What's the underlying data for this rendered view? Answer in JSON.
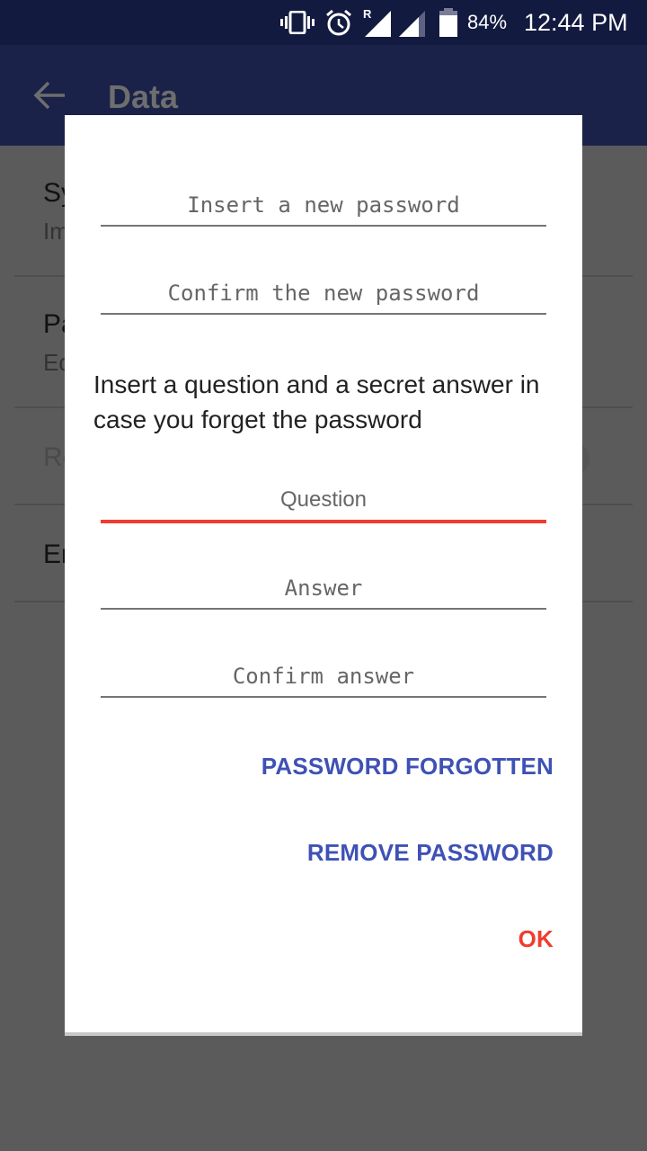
{
  "status_bar": {
    "icons": [
      "vibrate-icon",
      "alarm-icon",
      "signal-roaming-icon",
      "signal-icon",
      "battery-icon"
    ],
    "roaming_label": "R",
    "battery_percent": "84%",
    "time": "12:44 PM"
  },
  "app_bar": {
    "back_icon": "arrow-back-icon",
    "title": "Data"
  },
  "background_list": {
    "items": [
      {
        "title": "Sy",
        "subtitle": "Im"
      },
      {
        "title": "Pa",
        "subtitle": "Ed"
      },
      {
        "title": "Re",
        "subtitle": ""
      },
      {
        "title": "En",
        "subtitle": ""
      }
    ]
  },
  "dialog": {
    "new_password_placeholder": "Insert a new password",
    "confirm_password_placeholder": "Confirm the new password",
    "message": "Insert a question and a secret answer in case you forget the password",
    "question_placeholder": "Question",
    "answer_placeholder": "Answer",
    "confirm_answer_placeholder": "Confirm answer",
    "buttons": {
      "password_forgotten": "PASSWORD FORGOTTEN",
      "remove_password": "REMOVE PASSWORD",
      "ok": "OK"
    }
  },
  "colors": {
    "status_bar": "#131a40",
    "app_bar": "#1a2249",
    "accent_blue": "#3f51b5",
    "accent_red": "#f03c2e",
    "scrim": "#5b5b5b"
  }
}
